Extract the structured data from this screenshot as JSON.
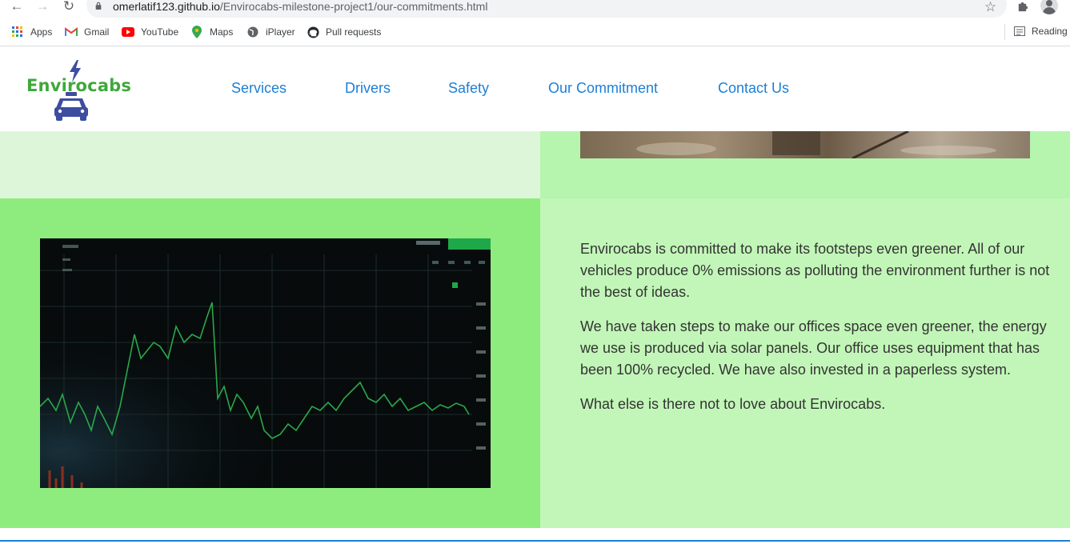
{
  "browser": {
    "url_host": "omerlatif123.github.io",
    "url_path": "/Envirocabs-milestone-project1/our-commitments.html",
    "bookmarks": [
      {
        "label": "Apps",
        "icon": "apps-grid-icon"
      },
      {
        "label": "Gmail",
        "icon": "gmail-icon"
      },
      {
        "label": "YouTube",
        "icon": "youtube-icon"
      },
      {
        "label": "Maps",
        "icon": "maps-pin-icon"
      },
      {
        "label": "iPlayer",
        "icon": "globe-icon"
      },
      {
        "label": "Pull requests",
        "icon": "github-icon"
      }
    ],
    "reading_list_label": "Reading"
  },
  "site": {
    "logo_text": "Envirocabs",
    "brand_green": "#3fa83b",
    "nav": [
      {
        "label": "Services"
      },
      {
        "label": "Drivers"
      },
      {
        "label": "Safety"
      },
      {
        "label": "Our Commitment"
      },
      {
        "label": "Contact Us"
      }
    ]
  },
  "commitment": {
    "paragraphs": [
      "Envirocabs is committed to make its footsteps even greener. All of our vehicles produce 0% emissions as polluting the environment further is not the best of ideas.",
      "We have taken steps to make our offices space even greener, the energy we use is produced via solar panels. Our office uses equipment that has been 100% recycled. We have also invested in a paperless system.",
      "What else is there not to love about Envirocabs."
    ]
  },
  "colors": {
    "nav_link": "#1c7fd6",
    "section_light": "#ddf6d9",
    "section_green": "#8eec7e",
    "section_pale": "#c2f6b8",
    "section_mint": "#b5f5ad"
  }
}
